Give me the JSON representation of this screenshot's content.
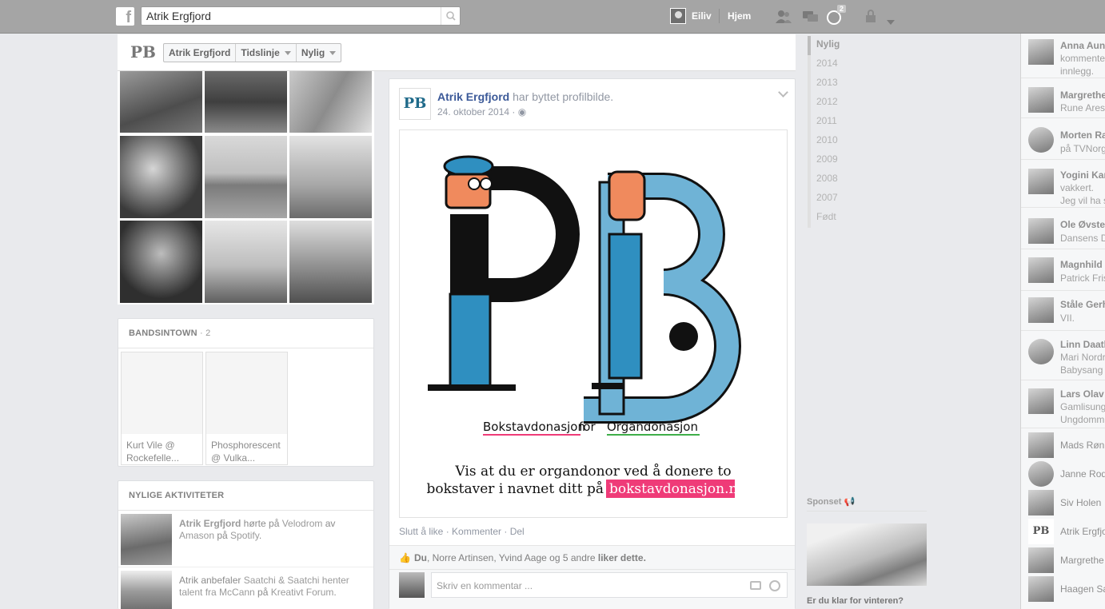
{
  "topbar": {
    "logo": "f",
    "search_value": "Atrik Ergfjord",
    "user_name": "Eiliv",
    "home_label": "Hjem",
    "notification_count": "2",
    "icons": [
      "friends-icon",
      "messages-icon",
      "notifications-globe-icon",
      "privacy-lock-icon",
      "settings-caret-icon"
    ]
  },
  "timeline_nav": {
    "logo_text": "PB",
    "name": "Atrik Ergfjord",
    "timeline_label": "Tidslinje",
    "recent_label": "Nylig"
  },
  "bandsintown": {
    "title": "BANDSINTOWN",
    "count": " · 2",
    "items": [
      {
        "line1": "Kurt Vile @",
        "line2": "Rockefelle..."
      },
      {
        "line1": "Phosphorescent",
        "line2": "@ Vulka..."
      }
    ]
  },
  "recent_activity": {
    "title": "NYLIGE AKTIVITETER",
    "items": [
      {
        "name": "Atrik Ergfjord",
        "verb1": " hørte på ",
        "track": "Velodrom",
        "verb2": " av ",
        "artist": "Amason",
        "verb3": " på ",
        "app": "Spotify",
        "end": "."
      },
      {
        "pre": "Atrik anbefaler ",
        "link1": "Saatchi & Saatchi henter talent fra McCann",
        "mid": " på ",
        "link2": "Kreativt Forum",
        "end": "."
      }
    ]
  },
  "story": {
    "avatar_text": "PB",
    "author": "Atrik Ergfjord",
    "action": " har byttet profilbilde.",
    "date": "24. oktober 2014 · ",
    "image": {
      "logo_p": "P",
      "logo_b": "B",
      "headline_left": "Bokstavdonasjon",
      "headline_mid": " for ",
      "headline_right": "Organdonasjon",
      "body_line1": "Vis at du er organdonor ved å donere to",
      "body_line2_pre": "bokstaver i navnet ditt på ",
      "body_link": "bokstavdonasjon.no",
      "accent_pink": "#ef3b78",
      "accent_green": "#3fae49",
      "accent_blue": "#2f8fc0"
    },
    "actions": "Slutt å like · Kommenter · Del",
    "likes": {
      "you": "Du",
      "others": ", Norre Artinsen, Yvind Aage",
      "and": " og ",
      "more": "5 andre",
      "end": " liker dette."
    },
    "comment_placeholder": "Skriv en kommentar ..."
  },
  "years": [
    "Nylig",
    "2014",
    "2013",
    "2012",
    "2011",
    "2010",
    "2009",
    "2008",
    "2007",
    "Født"
  ],
  "sponsored": {
    "label": "Sponset",
    "ad_title": "Er du klar for vinteren?"
  },
  "chat": [
    {
      "name": "Anna Aun",
      "lines": [
        "kommente",
        "innlegg."
      ]
    },
    {
      "name": "Margrethe",
      "lines": [
        "Rune Ares"
      ]
    },
    {
      "name": "Morten Ra",
      "lines": [
        "på TVNorg"
      ]
    },
    {
      "name": "Yogini Kar",
      "lines": [
        "vakkert.",
        "Jeg vil ha s"
      ]
    },
    {
      "name": "Ole Øvste",
      "lines": [
        "Dansens D"
      ]
    },
    {
      "name": "Magnhild",
      "lines": [
        "Patrick Fris"
      ]
    },
    {
      "name": "Ståle Gerh",
      "lines": [
        "VII."
      ]
    },
    {
      "name": "Linn Daatl",
      "lines": [
        "Mari Nordr",
        "Babysang"
      ]
    },
    {
      "name": "Lars Olav",
      "lines": [
        "Gamlisung",
        "Ungdomm"
      ]
    },
    {
      "name": "Mads Røn"
    },
    {
      "name": "Janne Rod"
    },
    {
      "name": "Siv Holen"
    },
    {
      "name": "Atrik Ergfjo"
    },
    {
      "name": "Margrethe"
    },
    {
      "name": "Haagen Sa"
    }
  ]
}
